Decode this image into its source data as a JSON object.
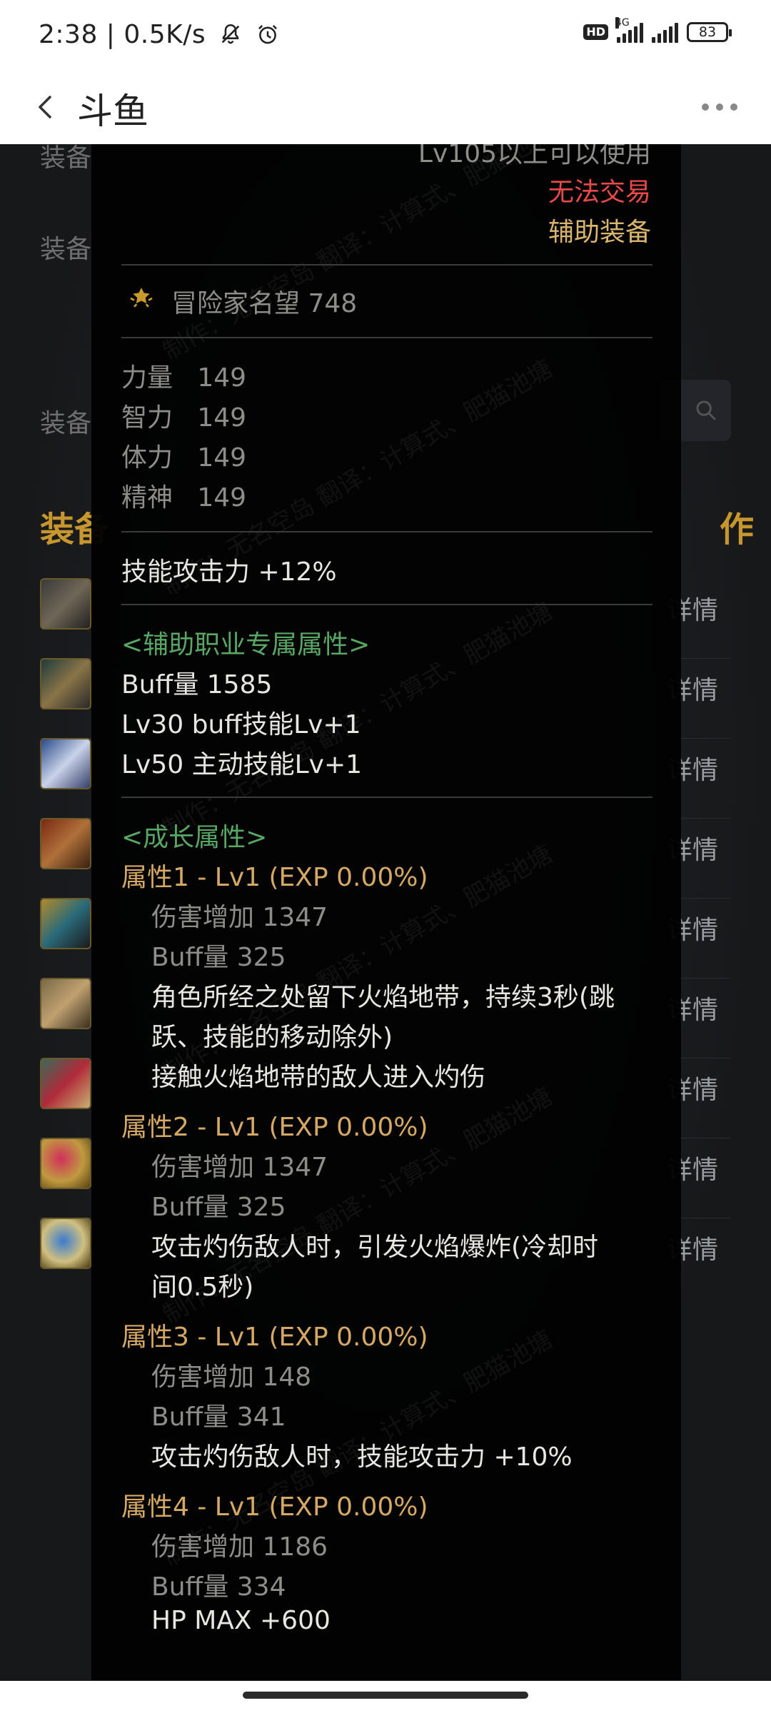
{
  "status": {
    "time": "2:38",
    "speed": "0.5K/s",
    "hd": "HD",
    "network": "4G",
    "battery": "83"
  },
  "appbar": {
    "title": "斗鱼"
  },
  "background": {
    "labels": [
      "装备",
      "装备",
      "装备"
    ],
    "header_left": "装备",
    "header_right": "作",
    "detail_label": "详情",
    "rows": 9
  },
  "tooltip": {
    "top_lines": {
      "level": "Lv105以上可以使用",
      "trade": "无法交易",
      "type": "辅助装备"
    },
    "reputation": "冒险家名望 748",
    "stats": [
      {
        "name": "力量",
        "value": "149"
      },
      {
        "name": "智力",
        "value": "149"
      },
      {
        "name": "体力",
        "value": "149"
      },
      {
        "name": "精神",
        "value": "149"
      }
    ],
    "skill_attack": "技能攻击力   +12%",
    "support_header": "<辅助职业专属属性>",
    "support_lines": [
      "Buff量   1585",
      "Lv30 buff技能Lv+1",
      "Lv50 主动技能Lv+1"
    ],
    "growth_header": "<成长属性>",
    "growth": [
      {
        "title": "属性1 - Lv1 (EXP 0.00%)",
        "dmg": "伤害增加   1347",
        "buff": "Buff量   325",
        "desc": [
          "角色所经之处留下火焰地带，持续3秒(跳",
          "跃、技能的移动除外)",
          "接触火焰地带的敌人进入灼伤"
        ]
      },
      {
        "title": "属性2 - Lv1 (EXP 0.00%)",
        "dmg": "伤害增加   1347",
        "buff": "Buff量   325",
        "desc": [
          "攻击灼伤敌人时，引发火焰爆炸(冷却时",
          "间0.5秒)"
        ]
      },
      {
        "title": "属性3 - Lv1 (EXP 0.00%)",
        "dmg": "伤害增加   148",
        "buff": "Buff量   341",
        "desc": [
          "攻击灼伤敌人时，技能攻击力 +10%"
        ]
      },
      {
        "title": "属性4 - Lv1 (EXP 0.00%)",
        "dmg": "伤害增加   1186",
        "buff": "Buff量   334",
        "desc": [
          "HP MAX +600"
        ]
      }
    ],
    "watermark": "制作：无名空岛  翻译：计算式、肥猫池塘"
  },
  "colors": {
    "gold": "#d9b66e",
    "green": "#58a765",
    "red": "#e84a4a",
    "gray": "#8e8d8a",
    "white": "#e8e6e1"
  }
}
